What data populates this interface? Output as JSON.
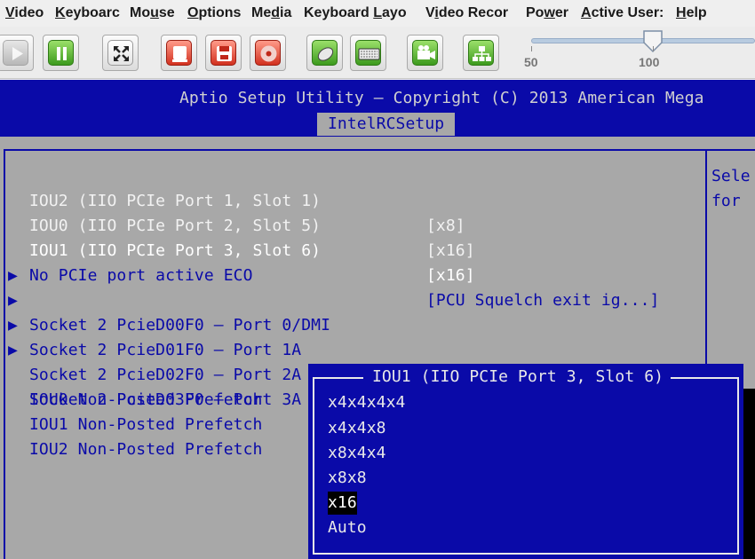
{
  "menubar": {
    "items": [
      {
        "pre": "",
        "u": "V",
        "post": "ideo"
      },
      {
        "pre": "",
        "u": "K",
        "post": "eyboarc"
      },
      {
        "pre": "Mo",
        "u": "u",
        "post": "se"
      },
      {
        "pre": "",
        "u": "O",
        "post": "ptions"
      },
      {
        "pre": "Me",
        "u": "d",
        "post": "ia"
      },
      {
        "pre": "Keyboard ",
        "u": "L",
        "post": "ayo"
      },
      {
        "pre": "V",
        "u": "i",
        "post": "deo Recor"
      },
      {
        "pre": "Po",
        "u": "w",
        "post": "er"
      },
      {
        "pre": "",
        "u": "A",
        "post": "ctive User:"
      },
      {
        "pre": "",
        "u": "H",
        "post": "elp"
      }
    ]
  },
  "toolbar": {
    "buttons": [
      "play-icon",
      "pause-icon",
      "fullscreen-icon",
      "record-icon",
      "save-icon",
      "disc-icon",
      "mouse-icon",
      "keyboard-icon",
      "camera-icon",
      "network-icon"
    ],
    "zoom": {
      "label_min": "50",
      "label_max": "100",
      "value_percent": 90
    }
  },
  "bios": {
    "title": "Aptio Setup Utility – Copyright (C) 2013 American Mega",
    "tab": "IntelRCSetup",
    "rows": [
      {
        "label": "IOU2 (IIO PCIe Port 1, Slot 1)",
        "value": "[x8]",
        "submenu": false,
        "white": false
      },
      {
        "label": "IOU0 (IIO PCIe Port 2, Slot 5)",
        "value": "[x16]",
        "submenu": false,
        "white": false
      },
      {
        "label": "IOU1 (IIO PCIe Port 3, Slot 6)",
        "value": "[x16]",
        "submenu": false,
        "white": true
      },
      {
        "label": "No PCIe port active ECO",
        "value": "[PCU Squelch exit ig...]",
        "submenu": false,
        "white": false
      },
      {
        "label": "Socket 2 PcieD00F0 – Port 0/DMI",
        "value": "",
        "submenu": true,
        "white": false
      },
      {
        "label": "Socket 2 PcieD01F0 – Port 1A",
        "value": "",
        "submenu": true,
        "white": false
      },
      {
        "label": "Socket 2 PcieD02F0 – Port 2A",
        "value": "",
        "submenu": true,
        "white": false
      },
      {
        "label": "Socket 2 PcieD03F0 – Port 3A",
        "value": "",
        "submenu": true,
        "white": false
      },
      {
        "label": "IOU0 Non-Posted Prefetch",
        "value": "",
        "submenu": false,
        "white": false
      },
      {
        "label": "IOU1 Non-Posted Prefetch",
        "value": "",
        "submenu": false,
        "white": false
      },
      {
        "label": "IOU2 Non-Posted Prefetch",
        "value": "",
        "submenu": false,
        "white": false
      }
    ],
    "help": [
      "Sele",
      "for "
    ],
    "popup": {
      "title": "IOU1 (IIO PCIe Port 3, Slot 6)",
      "options": [
        "x4x4x4x4",
        "x4x4x8",
        "x8x4x4",
        "x8x8",
        "x16",
        "Auto"
      ],
      "selected_index": 4
    },
    "colors": {
      "blue": "#0a0aa8",
      "gray": "#a8a8a8",
      "highlight": "#f2f2f2"
    }
  }
}
